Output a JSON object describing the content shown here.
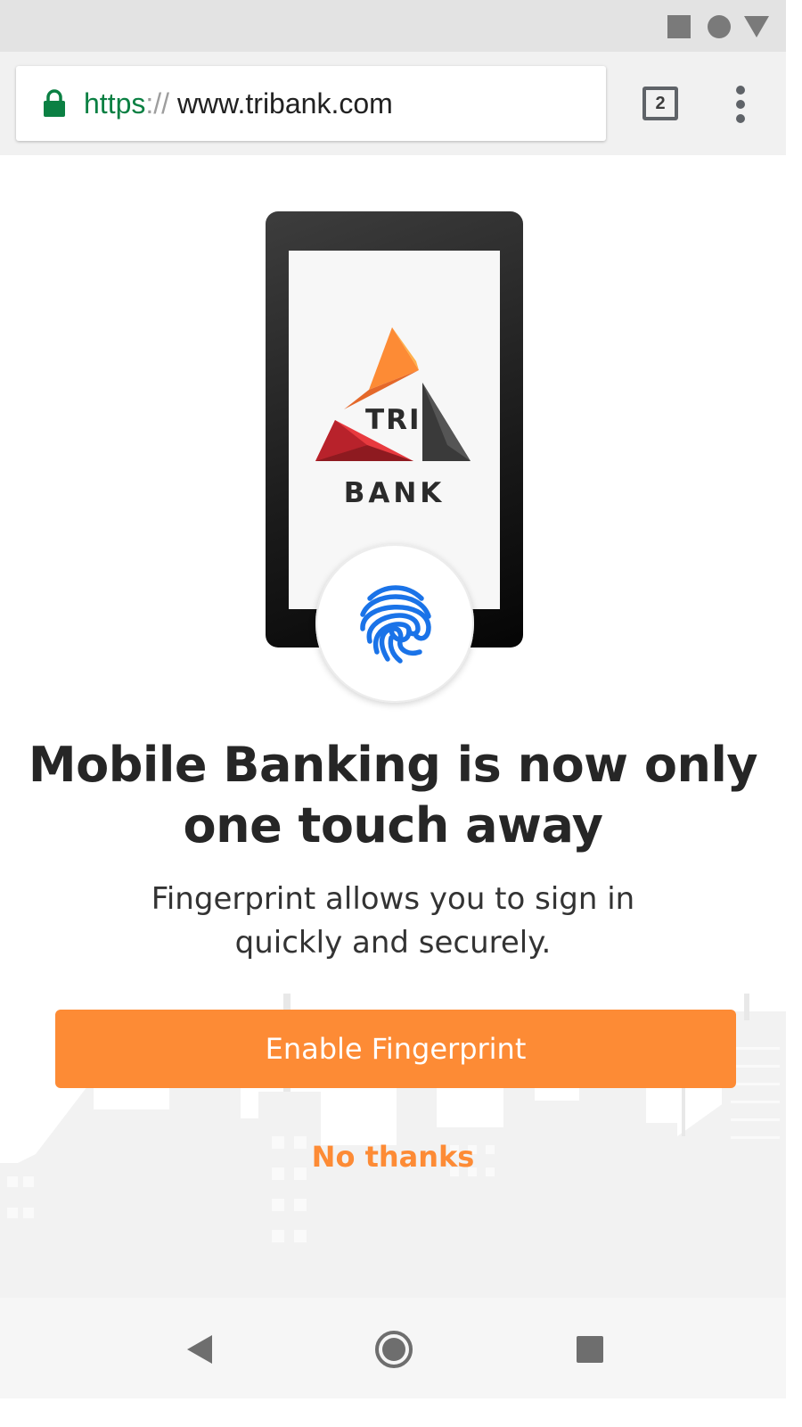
{
  "status_bar": {
    "icons": [
      "square-icon",
      "circle-icon",
      "triangle-icon"
    ]
  },
  "browser": {
    "url_scheme": "https",
    "url_separator": "://",
    "url_host": " www.tribank.com",
    "tab_count": "2",
    "icons": {
      "lock": "lock-icon",
      "menu": "more-vert-icon"
    },
    "colors": {
      "secure": "#0b8043"
    }
  },
  "main": {
    "logo_tri": "TRI",
    "logo_bank": "BANK",
    "title": "Mobile Banking is now only one touch away",
    "subtitle": "Fingerprint allows you to sign in quickly and securely.",
    "enable_button": "Enable Fingerprint",
    "no_thanks": "No thanks",
    "fingerprint_icon": "fingerprint-icon",
    "colors": {
      "accent": "#fd8b35",
      "fingerprint": "#1a73e8"
    }
  },
  "nav_bar": {
    "icons": [
      "back-icon",
      "home-icon",
      "recents-icon"
    ]
  }
}
